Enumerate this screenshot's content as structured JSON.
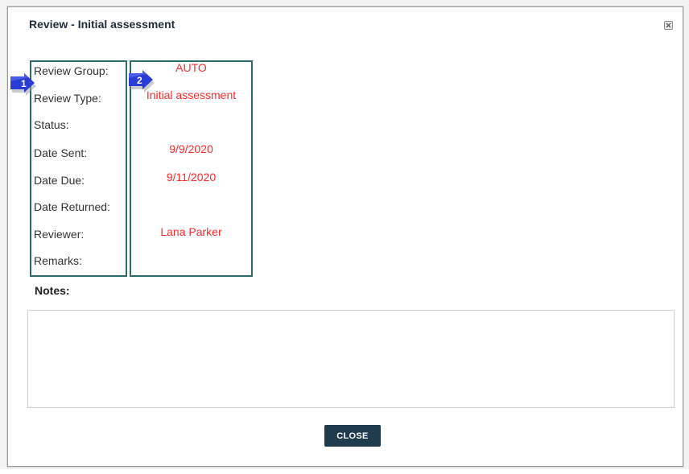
{
  "dialog": {
    "title": "Review - Initial assessment",
    "close_button": "CLOSE"
  },
  "fields": [
    {
      "label": "Review Group:",
      "value": "AUTO"
    },
    {
      "label": "Review Type:",
      "value": "Initial assessment"
    },
    {
      "label": "Status:",
      "value": ""
    },
    {
      "label": "Date Sent:",
      "value": "9/9/2020"
    },
    {
      "label": "Date Due:",
      "value": "9/11/2020"
    },
    {
      "label": "Date Returned:",
      "value": ""
    },
    {
      "label": "Reviewer:",
      "value": "Lana Parker"
    },
    {
      "label": "Remarks:",
      "value": ""
    }
  ],
  "markers": [
    "1",
    "2"
  ],
  "notes": {
    "label": "Notes:",
    "value": ""
  },
  "colors": {
    "value_text": "#ff2a2a",
    "box_border": "#2b6b6b",
    "button_bg": "#1f3b4d",
    "marker_fill": "#2a3bd6"
  }
}
